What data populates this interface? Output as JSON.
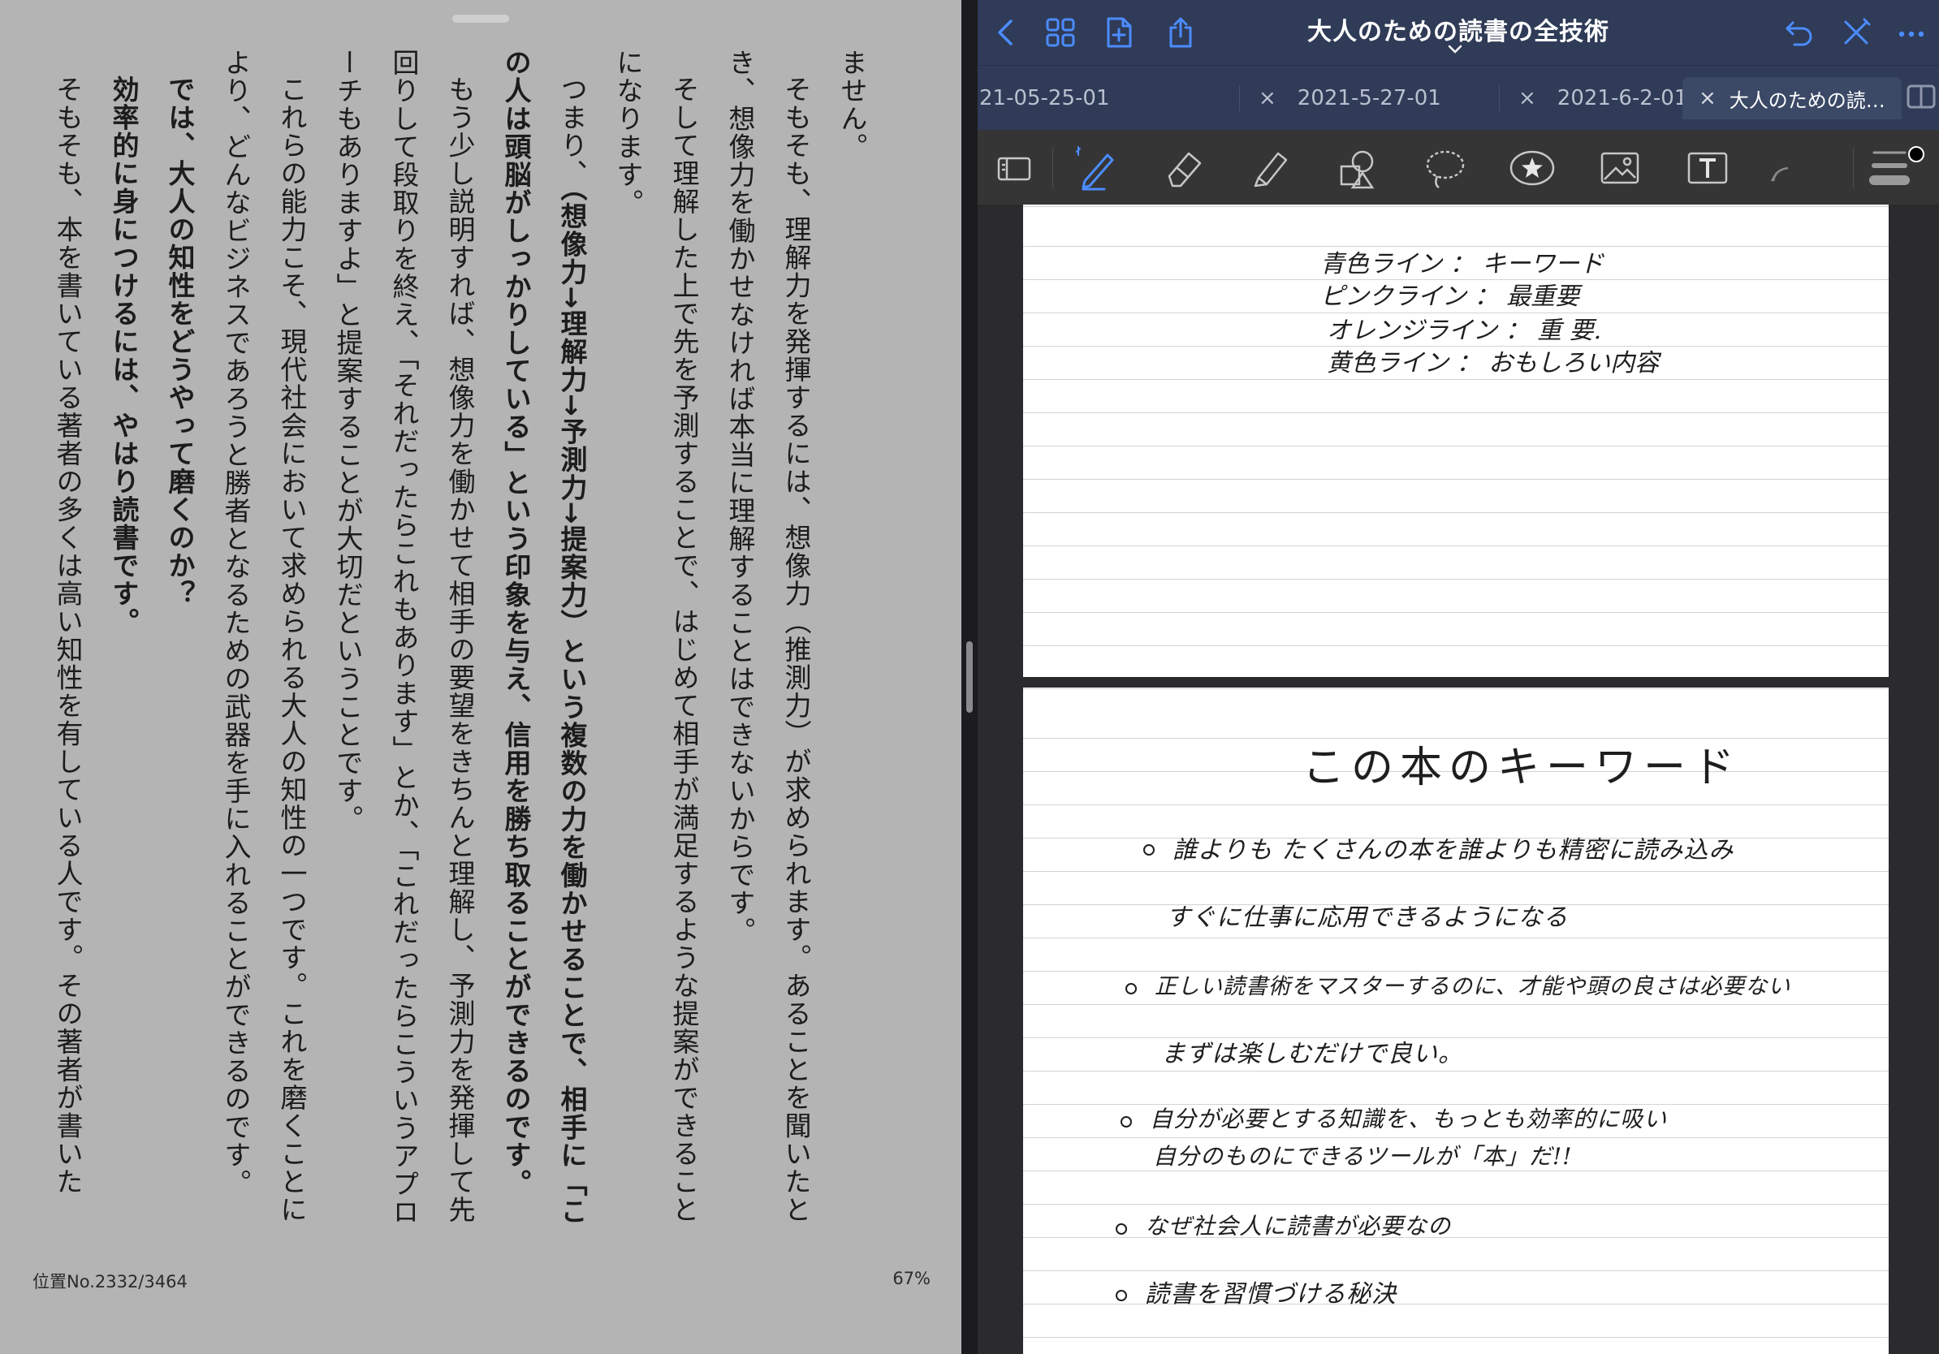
{
  "reader": {
    "paragraphs": [
      {
        "indent": false,
        "parts": [
          {
            "t": "ません。",
            "b": false
          }
        ]
      },
      {
        "indent": true,
        "parts": [
          {
            "t": "そもそも、理解力を発揮するには、想像力（推測力）が求められます。あることを聞いたとき、想像力を働かせなければ本当に理解することはできないからです。",
            "b": false
          }
        ]
      },
      {
        "indent": true,
        "parts": [
          {
            "t": "そして理解した上で先を予測することで、はじめて相手が満足するような提案ができることになります。",
            "b": false
          }
        ]
      },
      {
        "indent": true,
        "parts": [
          {
            "t": "つまり、",
            "b": false
          },
          {
            "t": "（想像力→理解力→予測力→提案力）という複数の力を働かせることで、相手に「この人は頭脳がしっかりしている」という印象を与え、信用を勝ち取ることができるのです。",
            "b": true
          }
        ]
      },
      {
        "indent": true,
        "parts": [
          {
            "t": "もう少し説明すれば、想像力を働かせて相手の要望をきちんと理解し、予測力を発揮して先回りして段取りを終え、「それだったらこれもあります」とか、「これだったらこういうアプローチもありますよ」と提案することが大切だということです。",
            "b": false
          }
        ]
      },
      {
        "indent": true,
        "parts": [
          {
            "t": "これらの能力こそ、現代社会において求められる大人の知性の一つです。これを磨くことにより、どんなビジネスであろうと勝者となるための武器を手に入れることができるのです。",
            "b": false
          }
        ]
      },
      {
        "indent": true,
        "parts": [
          {
            "t": "では、大人の知性をどうやって磨くのか？",
            "b": true
          }
        ]
      },
      {
        "indent": true,
        "parts": [
          {
            "t": "効率的に身につけるには、やはり読書です。",
            "b": true
          }
        ]
      },
      {
        "indent": true,
        "parts": [
          {
            "t": "そもそも、本を書いている著者の多くは高い知性を有している人です。その著者が書いた",
            "b": false
          }
        ]
      }
    ],
    "location": "位置No.2332/3464",
    "percent": "67%"
  },
  "notes": {
    "title": "大人のための読書の全技術",
    "tabs": [
      {
        "label": "21-05-25-01",
        "active": false,
        "show_close": false
      },
      {
        "label": "2021-5-27-01",
        "active": false,
        "show_close": true
      },
      {
        "label": "2021-6-2-01",
        "active": false,
        "show_close": true
      },
      {
        "label": "大人のための読…",
        "active": true,
        "show_close": true
      }
    ],
    "close_glyph": "×",
    "legend": [
      "青色ライン ： キーワード",
      "ピンクライン ： 最重要",
      "オレンジライン ： 重 要.",
      "黄色ライン ： おもしろい内容"
    ],
    "keywords_title": "この本のキーワード",
    "keywords": [
      "誰よりも たくさんの本を誰よりも精密に読み込み",
      "すぐに仕事に応用できるようになる",
      "正しい読書術をマスターするのに、才能や頭の良さは必要ない",
      "まずは楽しむだけで良い。",
      "自分が必要とする知識を、もっとも効率的に吸い",
      "自分のものにできるツールが「本」だ!!",
      "なぜ社会人に読書が必要なの",
      "読書を習慣づける秘決"
    ],
    "colors": {
      "nav_bg": "#2f3b57",
      "accent_blue": "#4c8cff",
      "toolbar_bg": "#353536",
      "reader_bg": "#b4b4b4"
    }
  }
}
